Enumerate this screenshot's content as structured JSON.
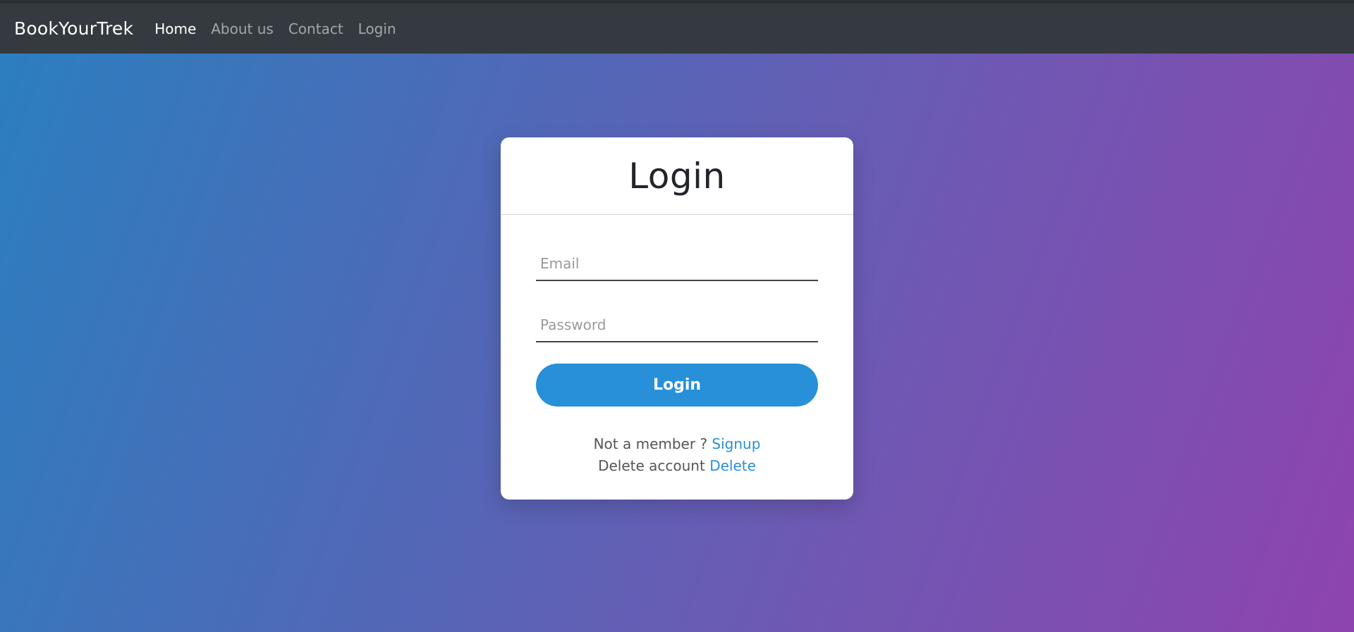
{
  "navbar": {
    "brand": "BookYourTrek",
    "links": [
      {
        "label": "Home"
      },
      {
        "label": "About us"
      },
      {
        "label": "Contact"
      },
      {
        "label": "Login"
      }
    ]
  },
  "login_card": {
    "title": "Login",
    "email_placeholder": "Email",
    "password_placeholder": "Password",
    "submit_label": "Login",
    "signup_prompt": "Not a member ?",
    "signup_link": "Signup",
    "delete_prompt": "Delete account",
    "delete_link": "Delete"
  },
  "colors": {
    "navbar_bg": "#343a40",
    "accent": "#2790d9",
    "gradient_start": "#2a7fbf",
    "gradient_end": "#8e44ad"
  }
}
